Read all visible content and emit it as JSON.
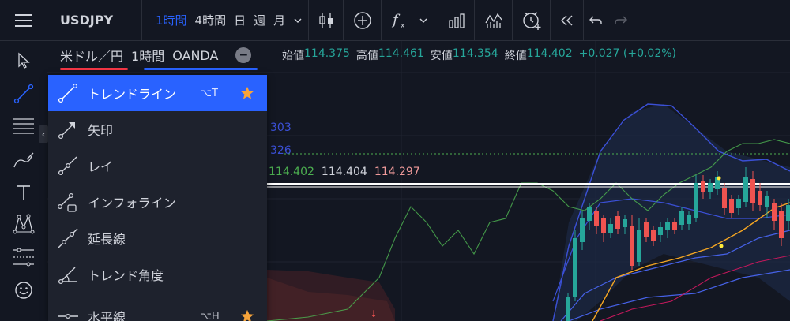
{
  "topbar": {
    "symbol": "USDJPY",
    "intervals": [
      {
        "label": "1時間",
        "active": true
      },
      {
        "label": "4時間",
        "active": false
      },
      {
        "label": "日",
        "active": false
      },
      {
        "label": "週",
        "active": false
      },
      {
        "label": "月",
        "active": false
      }
    ],
    "interval_chevron": "⌄",
    "tools": [
      "candles-icon",
      "add-compare-icon",
      "indicators-icon",
      "chevron-down-icon",
      "financials-icon",
      "alert-icon",
      "replay-add-icon",
      "rewind-icon",
      "undo-icon",
      "redo-icon"
    ]
  },
  "lefttoolbar": {
    "tools": [
      "cursor-icon",
      "trendline-icon",
      "fib-lines-icon",
      "brush-icon",
      "text-icon",
      "pattern-icon",
      "measure-icon",
      "emoji-icon"
    ],
    "collapse_glyph": "‹"
  },
  "legend": {
    "title": "米ドル／円",
    "interval": "1時間",
    "source": "OANDA",
    "minus": "−",
    "ohlc": {
      "open_label": "始値",
      "open": "114.375",
      "high_label": "高値",
      "high": "114.461",
      "low_label": "安値",
      "low": "114.354",
      "close_label": "終値",
      "close": "114.402",
      "change": "+0.027 (+0.02%)"
    },
    "indicator_partial_1": "303",
    "indicator_partial_2": "326",
    "indicator_values": {
      "a": "114.402",
      "b": "114.404",
      "c": "114.297"
    }
  },
  "menu": {
    "items": [
      {
        "label": "トレンドライン",
        "shortcut": "⌥T",
        "starred": true,
        "active": true,
        "icon": "trendline-icon"
      },
      {
        "label": "矢印",
        "shortcut": "",
        "starred": false,
        "active": false,
        "icon": "arrow-icon"
      },
      {
        "label": "レイ",
        "shortcut": "",
        "starred": false,
        "active": false,
        "icon": "ray-icon"
      },
      {
        "label": "インフォライン",
        "shortcut": "",
        "starred": false,
        "active": false,
        "icon": "info-line-icon"
      },
      {
        "label": "延長線",
        "shortcut": "",
        "starred": false,
        "active": false,
        "icon": "extended-line-icon"
      },
      {
        "label": "トレンド角度",
        "shortcut": "",
        "starred": false,
        "active": false,
        "icon": "trend-angle-icon"
      },
      {
        "label": "水平線",
        "shortcut": "⌥H",
        "starred": true,
        "active": false,
        "icon": "horizontal-line-icon"
      }
    ]
  },
  "colors": {
    "accent": "#2962ff",
    "up": "#26a69a",
    "down": "#ef5350",
    "star": "#f7a43a",
    "bg": "#131722"
  }
}
